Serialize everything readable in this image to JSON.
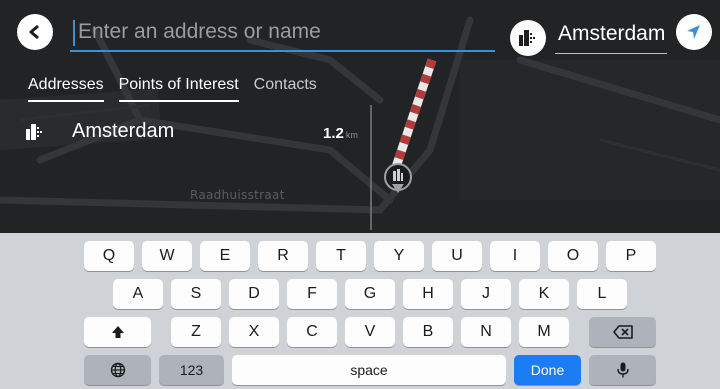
{
  "search": {
    "placeholder": "Enter an address or name",
    "value": ""
  },
  "city": {
    "value": "Amsterdam"
  },
  "tabs": [
    {
      "label": "Addresses",
      "active": false
    },
    {
      "label": "Points of Interest",
      "active": true
    },
    {
      "label": "Contacts",
      "active": false
    }
  ],
  "results": [
    {
      "name": "Amsterdam",
      "distance": "1.2",
      "unit": "km",
      "icon": "city-icon"
    }
  ],
  "map": {
    "street_label": "Raadhuisstraat"
  },
  "keyboard": {
    "row1": [
      "Q",
      "W",
      "E",
      "R",
      "T",
      "Y",
      "U",
      "I",
      "O",
      "P"
    ],
    "row2": [
      "A",
      "S",
      "D",
      "F",
      "G",
      "H",
      "J",
      "K",
      "L"
    ],
    "row3": [
      "Z",
      "X",
      "C",
      "V",
      "B",
      "N",
      "M"
    ],
    "numbers_label": "123",
    "space_label": "space",
    "done_label": "Done"
  },
  "colors": {
    "accent": "#1c7cf4",
    "underline": "#3d8fd6",
    "route_stripe": "#b33a3a"
  },
  "icons": [
    "back-arrow-icon",
    "city-icon",
    "location-arrow-icon",
    "shift-icon",
    "backspace-icon",
    "globe-icon",
    "microphone-icon",
    "map-pin-icon"
  ]
}
